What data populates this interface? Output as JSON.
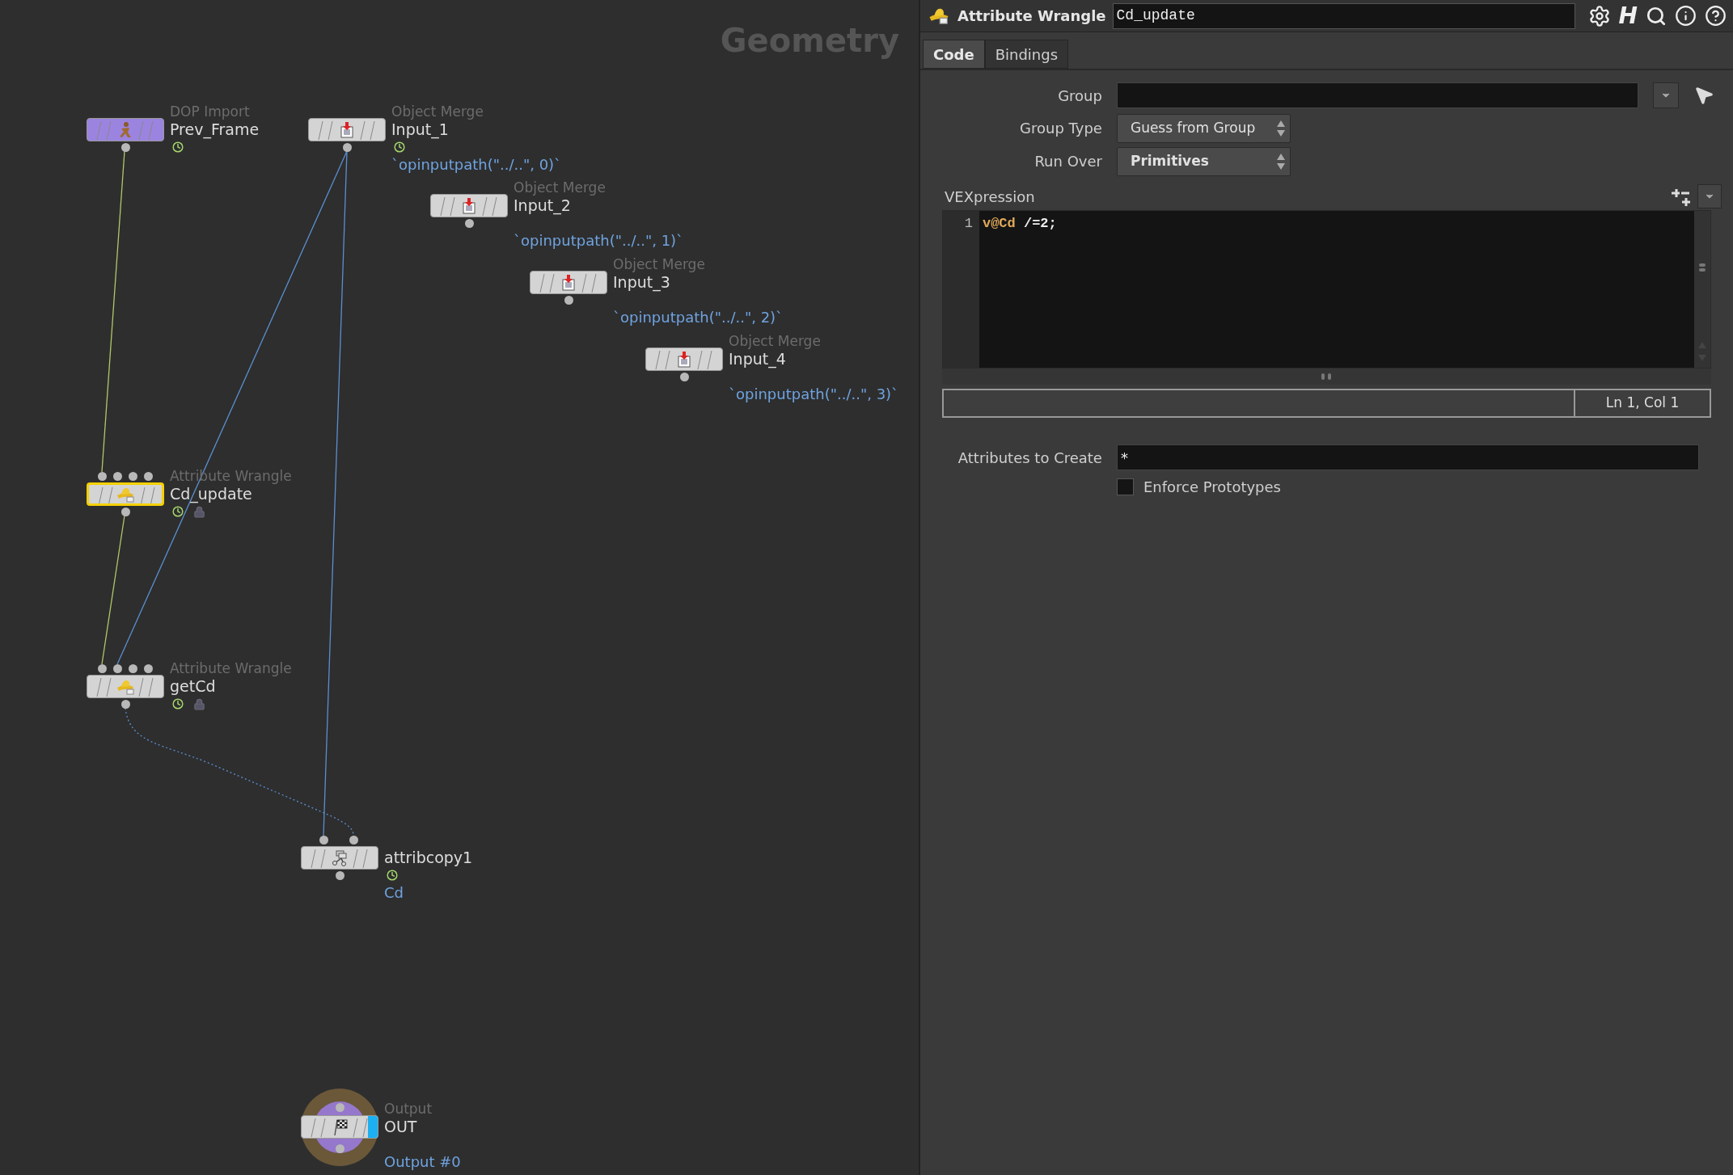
{
  "network": {
    "title": "Geometry",
    "nodes": [
      {
        "kind": "dop_import",
        "type_label": "DOP Import",
        "name": "Prev_Frame",
        "selected": false,
        "time_dependent": true,
        "display": false
      },
      {
        "kind": "object_merge",
        "type_label": "Object Merge",
        "name": "Input_1",
        "selected": false,
        "time_dependent": true,
        "display": false,
        "expression": "`opinputpath(\"../..\", 0)`"
      },
      {
        "kind": "object_merge",
        "type_label": "Object Merge",
        "name": "Input_2",
        "selected": false,
        "time_dependent": false,
        "display": false,
        "expression": "`opinputpath(\"../..\", 1)`"
      },
      {
        "kind": "object_merge",
        "type_label": "Object Merge",
        "name": "Input_3",
        "selected": false,
        "time_dependent": false,
        "display": false,
        "expression": "`opinputpath(\"../..\", 2)`"
      },
      {
        "kind": "object_merge",
        "type_label": "Object Merge",
        "name": "Input_4",
        "selected": false,
        "time_dependent": false,
        "display": false,
        "expression": "`opinputpath(\"../..\", 3)`"
      },
      {
        "kind": "wrangle",
        "type_label": "Attribute Wrangle",
        "name": "Cd_update",
        "selected": true,
        "time_dependent": true,
        "display": false
      },
      {
        "kind": "wrangle",
        "type_label": "Attribute Wrangle",
        "name": "getCd",
        "selected": false,
        "time_dependent": true,
        "display": false
      },
      {
        "kind": "attribcopy",
        "name": "attribcopy1",
        "selected": false,
        "time_dependent": true,
        "display": false,
        "expression": "Cd"
      },
      {
        "kind": "output",
        "type_label": "Output",
        "name": "OUT",
        "selected": false,
        "time_dependent": false,
        "display": true,
        "expression": "Output #0"
      }
    ]
  },
  "parameters": {
    "header": {
      "type_label": "Attribute Wrangle",
      "name": "Cd_update",
      "help_logo": "H"
    },
    "tabs": [
      {
        "label": "Code",
        "selected": true
      },
      {
        "label": "Bindings",
        "selected": false
      }
    ],
    "group": {
      "label": "Group"
    },
    "group_type": {
      "label": "Group Type",
      "value": "Guess from Group"
    },
    "run_over": {
      "label": "Run Over",
      "value": "Primitives"
    },
    "vexpression": {
      "label": "VEXpression",
      "lines": [
        {
          "number": "1",
          "tokens": [
            {
              "kind": "attribute",
              "text": "v@Cd"
            },
            {
              "kind": "plain",
              "text": " /=2;"
            }
          ]
        }
      ]
    },
    "status": "Ln 1, Col 1",
    "attributes_to_create": {
      "label": "Attributes to Create",
      "value": "*"
    },
    "enforce_prototypes": {
      "label": "Enforce Prototypes",
      "checked": false
    }
  }
}
